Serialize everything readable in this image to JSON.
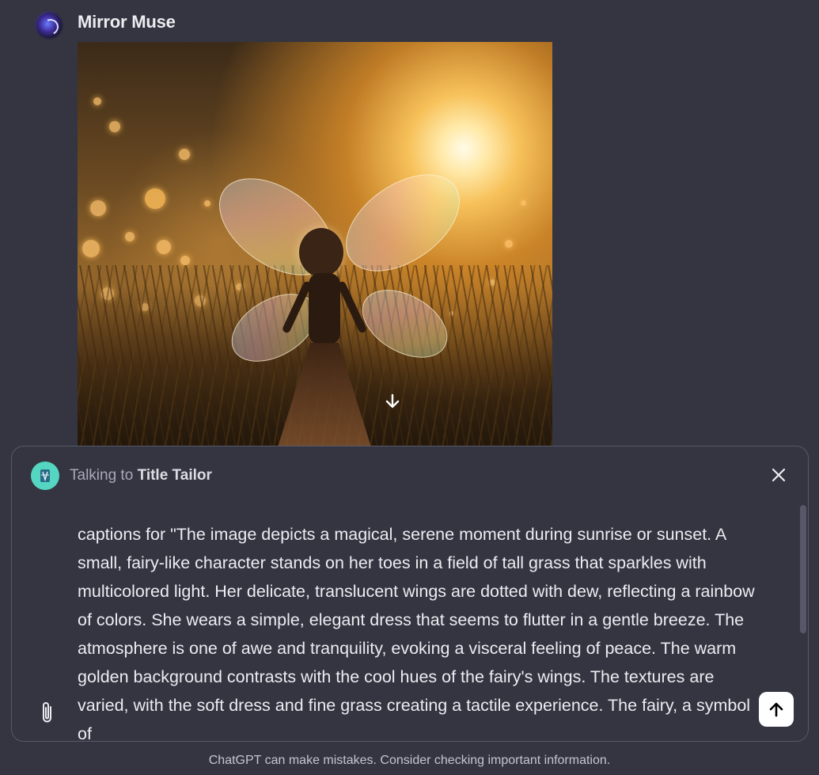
{
  "assistant": {
    "name": "Mirror Muse",
    "avatar_icon": "galaxy-swirl-avatar"
  },
  "image": {
    "alt": "",
    "download_icon": "arrow-down-icon"
  },
  "composer": {
    "talking_prefix": "Talking to",
    "gpt_name": "Title Tailor",
    "gpt_avatar_icon": "tailor-avatar-icon",
    "close_icon": "close-icon",
    "text": "captions for \"The image depicts a magical, serene moment during sunrise or sunset. A small, fairy-like character stands on her toes in a field of tall grass that sparkles with multicolored light. Her delicate, translucent wings are dotted with dew, reflecting a rainbow of colors. She wears a simple, elegant dress that seems to flutter in a gentle breeze. The atmosphere is one of awe and tranquility, evoking a visceral feeling of peace. The warm golden background contrasts with the cool hues of the fairy's wings. The textures are varied, with the soft dress and fine grass creating a tactile experience. The fairy, a symbol of",
    "attach_icon": "paperclip-icon",
    "send_icon": "arrow-up-icon"
  },
  "footer": {
    "disclaimer": "ChatGPT can make mistakes. Consider checking important information."
  },
  "colors": {
    "background": "#343541",
    "border": "#565869",
    "text": "#ececf1",
    "gpt_avatar": "#55d6c2"
  }
}
